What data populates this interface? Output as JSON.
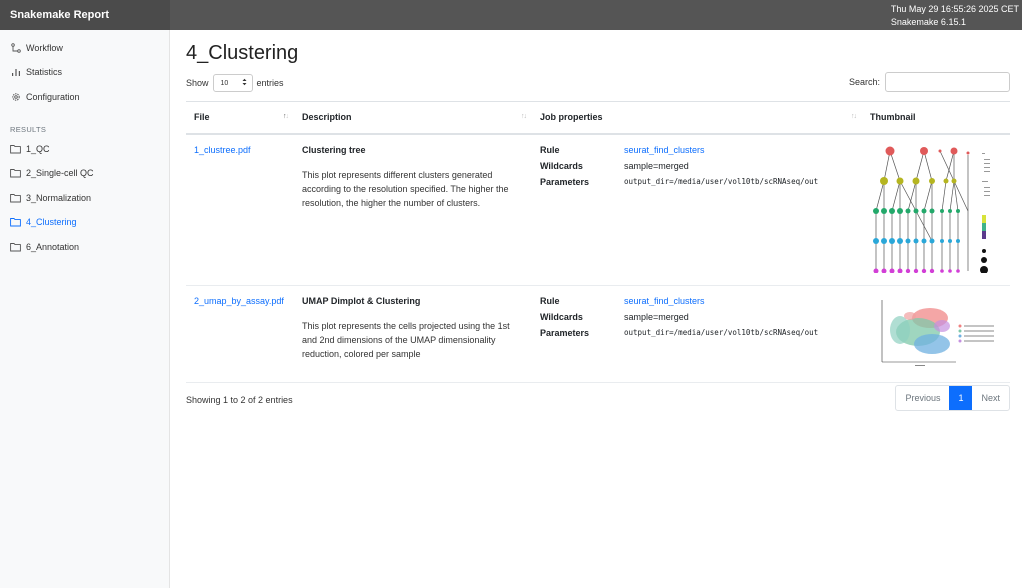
{
  "header": {
    "brand": "Snakemake Report",
    "timestamp": "Thu May 29 16:55:26 2025 CET",
    "version": "Snakemake 6.15.1"
  },
  "sidebar": {
    "items": [
      {
        "label": "Workflow",
        "icon": "workflow-icon"
      },
      {
        "label": "Statistics",
        "icon": "bar-chart-icon"
      },
      {
        "label": "Configuration",
        "icon": "gear-icon"
      }
    ],
    "section_label": "RESULTS",
    "results": [
      {
        "label": "1_QC"
      },
      {
        "label": "2_Single-cell QC"
      },
      {
        "label": "3_Normalization"
      },
      {
        "label": "4_Clustering"
      },
      {
        "label": "6_Annotation"
      }
    ]
  },
  "main": {
    "title": "4_Clustering",
    "show_label": "Show",
    "entries_value": "10",
    "entries_label": "entries",
    "search_label": "Search:",
    "search_value": "",
    "columns": [
      "File",
      "Description",
      "Job properties",
      "Thumbnail"
    ],
    "rows": [
      {
        "file": "1_clustree.pdf",
        "desc_title": "Clustering tree",
        "desc_text": "This plot represents different clusters generated according to the resolution specified. The higher the resolution, the higher the number of clusters.",
        "rule_label": "Rule",
        "rule": "seurat_find_clusters",
        "wildcards_label": "Wildcards",
        "wildcards": "sample=merged",
        "params_label": "Parameters",
        "params": "output_dir=/media/user/vol10tb/scRNAseq/out"
      },
      {
        "file": "2_umap_by_assay.pdf",
        "desc_title": "UMAP Dimplot & Clustering",
        "desc_text": "This plot represents the cells projected using the 1st and 2nd dimensions of the UMAP dimensionality reduction, colored per sample",
        "rule_label": "Rule",
        "rule": "seurat_find_clusters",
        "wildcards_label": "Wildcards",
        "wildcards": "sample=merged",
        "params_label": "Parameters",
        "params": "output_dir=/media/user/vol10tb/scRNAseq/out"
      }
    ],
    "footer_info": "Showing 1 to 2 of 2 entries",
    "pager": {
      "previous": "Previous",
      "current": "1",
      "next": "Next"
    }
  },
  "colors": {
    "accent": "#0d6efd",
    "topbar": "#555555"
  }
}
